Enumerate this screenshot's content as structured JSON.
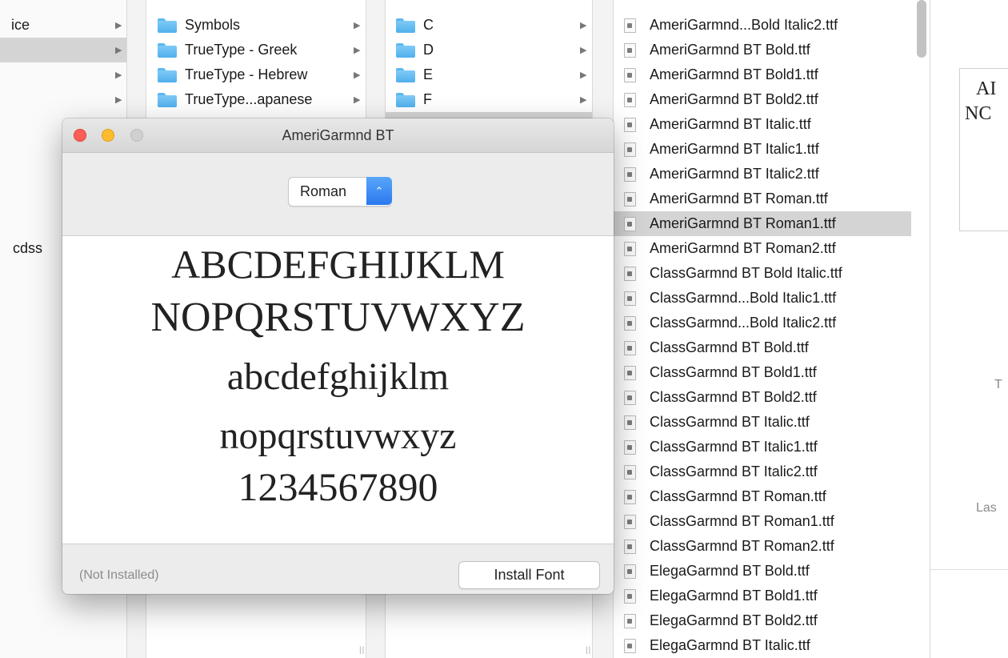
{
  "column1": {
    "rows": [
      {
        "label": "ice",
        "selected": false
      },
      {
        "label": "",
        "selected": true
      },
      {
        "label": "",
        "selected": false
      },
      {
        "label": "",
        "selected": false
      }
    ],
    "partial_label": "cdss"
  },
  "column2": {
    "rows": [
      {
        "label": "Symbols"
      },
      {
        "label": "TrueType - Greek"
      },
      {
        "label": "TrueType - Hebrew"
      },
      {
        "label": "TrueType...apanese"
      }
    ]
  },
  "column3": {
    "rows": [
      {
        "label": "C"
      },
      {
        "label": "D"
      },
      {
        "label": "E"
      },
      {
        "label": "F"
      }
    ]
  },
  "column4": {
    "files": [
      "AmeriGarmnd...Bold Italic2.ttf",
      "AmeriGarmnd BT Bold.ttf",
      "AmeriGarmnd BT Bold1.ttf",
      "AmeriGarmnd BT Bold2.ttf",
      "AmeriGarmnd BT Italic.ttf",
      "AmeriGarmnd BT Italic1.ttf",
      "AmeriGarmnd BT Italic2.ttf",
      "AmeriGarmnd BT Roman.ttf",
      "AmeriGarmnd BT Roman1.ttf",
      "AmeriGarmnd BT Roman2.ttf",
      "ClassGarmnd BT Bold Italic.ttf",
      "ClassGarmnd...Bold Italic1.ttf",
      "ClassGarmnd...Bold Italic2.ttf",
      "ClassGarmnd BT Bold.ttf",
      "ClassGarmnd BT Bold1.ttf",
      "ClassGarmnd BT Bold2.ttf",
      "ClassGarmnd BT Italic.ttf",
      "ClassGarmnd BT Italic1.ttf",
      "ClassGarmnd BT Italic2.ttf",
      "ClassGarmnd BT Roman.ttf",
      "ClassGarmnd BT Roman1.ttf",
      "ClassGarmnd BT Roman2.ttf",
      "ElegaGarmnd BT Bold.ttf",
      "ElegaGarmnd BT Bold1.ttf",
      "ElegaGarmnd BT Bold2.ttf",
      "ElegaGarmnd BT Italic.ttf"
    ],
    "selected_index": 8
  },
  "preview_panel": {
    "thumb_line1": "AI",
    "thumb_line2": "NC",
    "label_t": "T",
    "label_las": "Las"
  },
  "font_window": {
    "title": "AmeriGarmnd BT",
    "style_popup": "Roman",
    "sample_lines": [
      "ABCDEFGHIJKLM",
      "NOPQRSTUVWXYZ",
      "abcdefghijklm",
      "nopqrstuvwxyz",
      "1234567890"
    ],
    "status": "(Not Installed)",
    "install_label": "Install Font"
  },
  "colors": {
    "close": "#fc5f57",
    "minimize": "#fdbc2e",
    "zoom_inactive": "#d0d0d0",
    "selection": "#d4d4d4",
    "folder": "#5cb8ef",
    "popup_accent": "#2f7ff0"
  },
  "icons": {
    "folder": "folder-icon",
    "file": "ttf-file-icon",
    "disclosure": "disclosure-arrow-icon",
    "stepper": "popup-stepper-icon"
  }
}
